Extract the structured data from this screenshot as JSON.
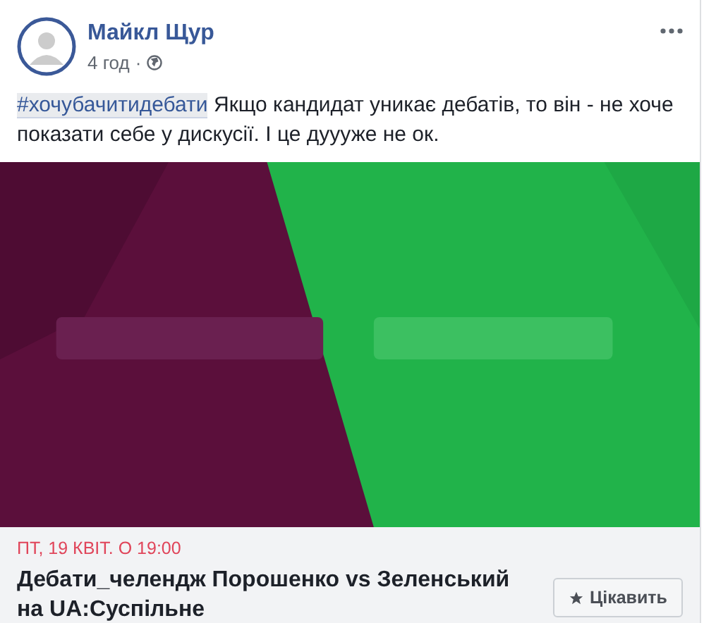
{
  "post": {
    "author": "Майкл Щур",
    "time": "4 год",
    "separator": "·",
    "hashtag": "#хочубачитидебати",
    "text": " Якщо кандидат уникає дебатів, то він - не хоче показати себе у дискусії. І це дуууже не ок."
  },
  "event": {
    "date": "ПТ, 19 КВІТ. О 19:00",
    "title": "Дебати_челендж Порошенко vs Зеленський на UA:Суспільне",
    "button": "Цікавить"
  }
}
